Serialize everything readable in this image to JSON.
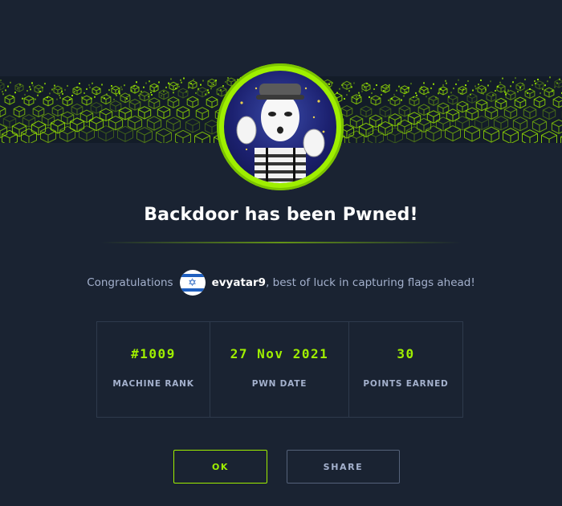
{
  "banner": {
    "icon": "hex-cube-pattern"
  },
  "avatar": {
    "icon": "mime-avatar",
    "ring_color": "#9fef00"
  },
  "title": "Backdoor has been Pwned!",
  "congrats": {
    "prefix": "Congratulations",
    "flag_icon": "israel-flag-icon",
    "username": "evyatar9",
    "suffix": ", best of luck in capturing flags ahead!"
  },
  "stats": [
    {
      "value": "#1009",
      "label": "MACHINE RANK"
    },
    {
      "value": "27 Nov 2021",
      "label": "PWN DATE"
    },
    {
      "value": "30",
      "label": "POINTS EARNED"
    }
  ],
  "buttons": {
    "ok": "OK",
    "share": "SHARE"
  },
  "colors": {
    "accent": "#9fef00",
    "background": "#1a2332",
    "muted": "#a4b1cd"
  }
}
